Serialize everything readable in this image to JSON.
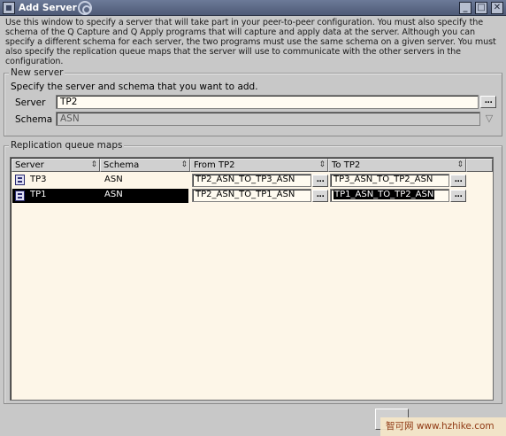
{
  "window": {
    "title": "Add Server",
    "minimize_glyph": "_",
    "maximize_glyph": "□",
    "close_glyph": "✕"
  },
  "intro_text": "Use this window to specify a server that will take part in your peer-to-peer configuration. You must also specify the schema of the Q Capture and Q Apply programs that will capture and apply data at the server. Although you can specify a different schema for each server, the two programs must use the same schema on a given server. You must also specify the replication queue maps that the server will use to communicate with the other servers in the configuration.",
  "new_server": {
    "group_title": "New server",
    "instruction": "Specify the server and schema that you want to add.",
    "server_label": "Server",
    "server_value": "TP2",
    "schema_label": "Schema",
    "schema_value": "ASN",
    "ellipsis": "...",
    "dropdown_arrow": "▽"
  },
  "queue_maps": {
    "group_title": "Replication queue maps",
    "columns": [
      "Server",
      "Schema",
      "From TP2",
      "To TP2"
    ],
    "sort_glyph": "⇕",
    "ellipsis": "...",
    "rows": [
      {
        "server": "TP3",
        "schema": "ASN",
        "from": "TP2_ASN_TO_TP3_ASN",
        "to": "TP3_ASN_TO_TP2_ASN",
        "selected": false
      },
      {
        "server": "TP1",
        "schema": "ASN",
        "from": "TP2_ASN_TO_TP1_ASN",
        "to": "TP1_ASN_TO_TP2_ASN",
        "selected": true
      }
    ]
  },
  "watermark": "智可网 www.hzhike.com"
}
